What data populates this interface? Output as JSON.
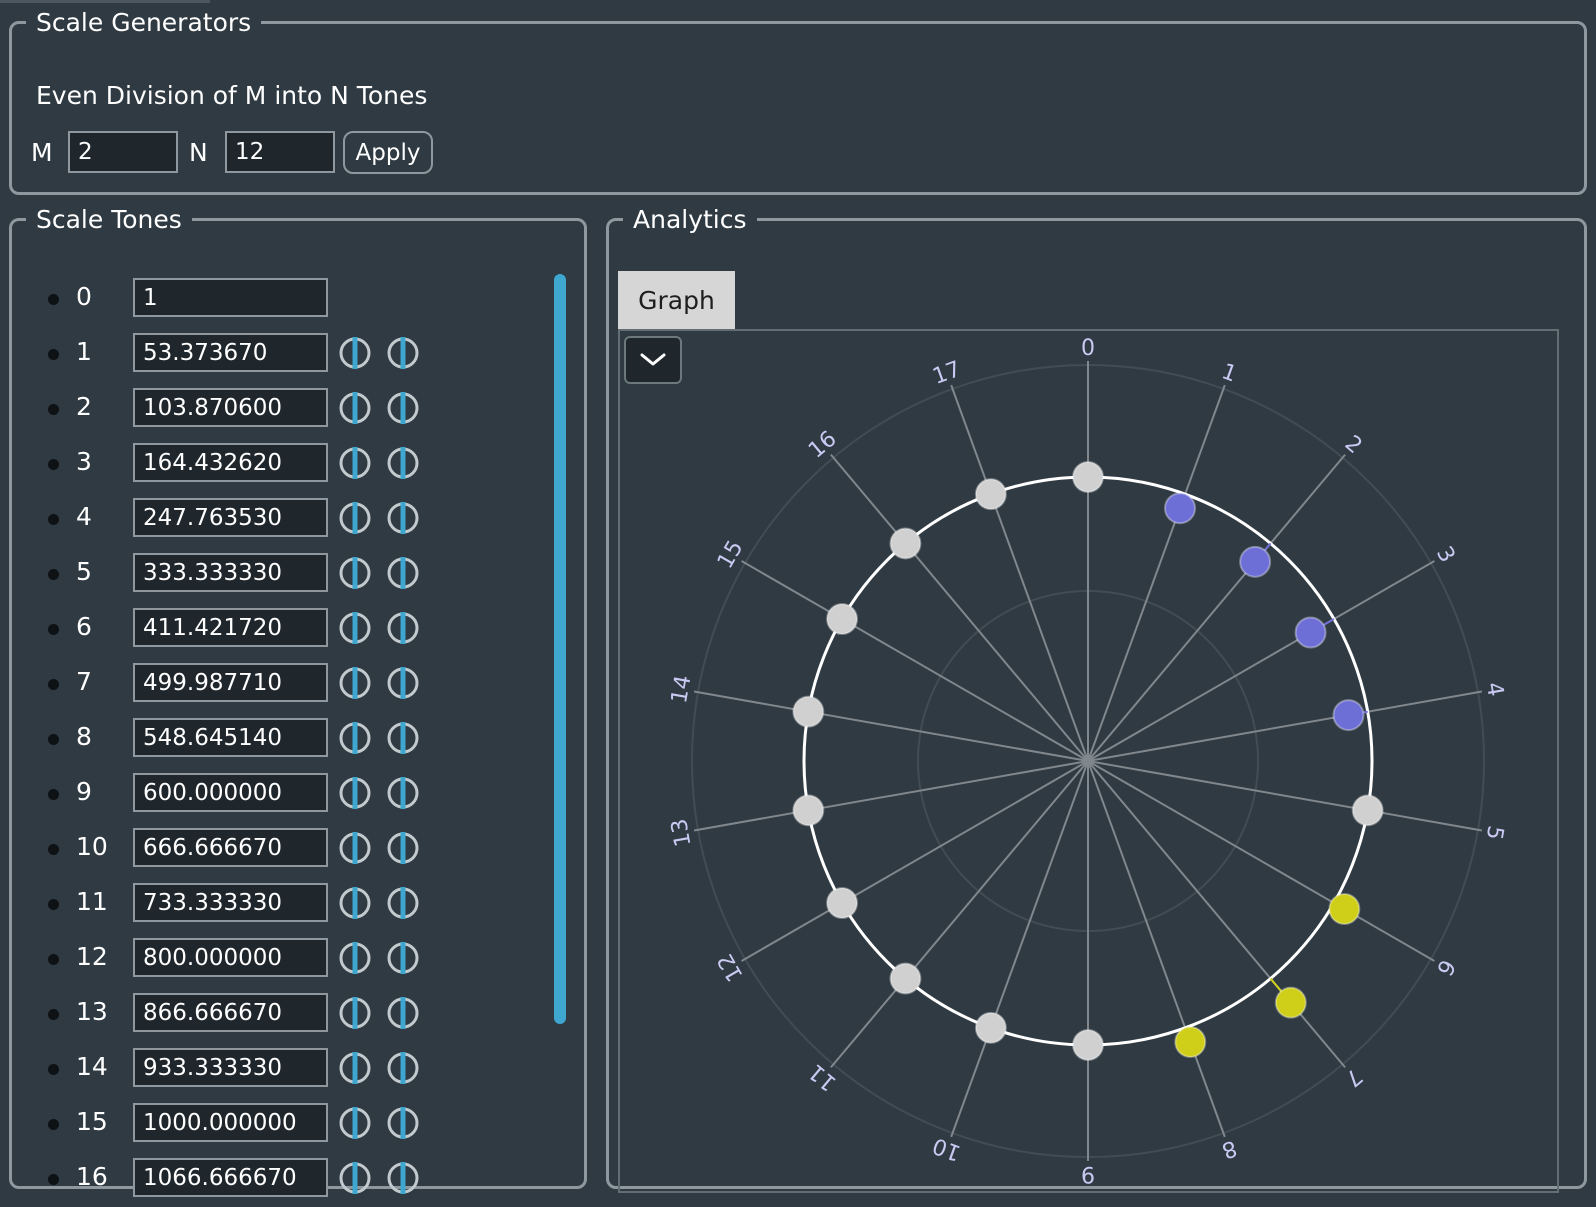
{
  "generators": {
    "legend": "Scale Generators",
    "title": "Even Division of M into N Tones",
    "m_label": "M",
    "m_value": "2",
    "n_label": "N",
    "n_value": "12",
    "apply_label": "Apply"
  },
  "tones": {
    "legend": "Scale Tones",
    "items": [
      {
        "index": "0",
        "value": "1"
      },
      {
        "index": "1",
        "value": "53.373670"
      },
      {
        "index": "2",
        "value": "103.870600"
      },
      {
        "index": "3",
        "value": "164.432620"
      },
      {
        "index": "4",
        "value": "247.763530"
      },
      {
        "index": "5",
        "value": "333.333330"
      },
      {
        "index": "6",
        "value": "411.421720"
      },
      {
        "index": "7",
        "value": "499.987710"
      },
      {
        "index": "8",
        "value": "548.645140"
      },
      {
        "index": "9",
        "value": "600.000000"
      },
      {
        "index": "10",
        "value": "666.666670"
      },
      {
        "index": "11",
        "value": "733.333330"
      },
      {
        "index": "12",
        "value": "800.000000"
      },
      {
        "index": "13",
        "value": "866.666670"
      },
      {
        "index": "14",
        "value": "933.333330"
      },
      {
        "index": "15",
        "value": "1000.000000"
      },
      {
        "index": "16",
        "value": "1066.666670"
      }
    ]
  },
  "analytics": {
    "legend": "Analytics",
    "tab_label": "Graph",
    "dropdown_icon": "chevron-down-icon",
    "colors": {
      "neutral": "#d0d0d0",
      "flat": "#6d6fd6",
      "sharp": "#cfcf1a",
      "ring": "#ffffff",
      "label": "#c9c9f2"
    }
  },
  "chart_data": {
    "type": "polar",
    "spoke_labels": [
      "0",
      "1",
      "2",
      "3",
      "4",
      "5",
      "6",
      "7",
      "8",
      "9",
      "10",
      "11",
      "12",
      "13",
      "14",
      "15",
      "16",
      "17"
    ],
    "points": [
      {
        "spoke": 0,
        "deviation": 0,
        "status": "neutral"
      },
      {
        "spoke": 1,
        "deviation": -0.1,
        "status": "flat"
      },
      {
        "spoke": 2,
        "deviation": -0.16,
        "status": "flat"
      },
      {
        "spoke": 3,
        "deviation": -0.18,
        "status": "flat"
      },
      {
        "spoke": 4,
        "deviation": -0.13,
        "status": "flat"
      },
      {
        "spoke": 5,
        "deviation": 0,
        "status": "neutral"
      },
      {
        "spoke": 6,
        "deviation": 0.08,
        "status": "sharp"
      },
      {
        "spoke": 7,
        "deviation": 0.21,
        "status": "sharp"
      },
      {
        "spoke": 8,
        "deviation": 0.1,
        "status": "sharp"
      },
      {
        "spoke": 9,
        "deviation": 0,
        "status": "neutral"
      },
      {
        "spoke": 10,
        "deviation": 0,
        "status": "neutral"
      },
      {
        "spoke": 11,
        "deviation": 0,
        "status": "neutral"
      },
      {
        "spoke": 12,
        "deviation": 0,
        "status": "neutral"
      },
      {
        "spoke": 13,
        "deviation": 0,
        "status": "neutral"
      },
      {
        "spoke": 14,
        "deviation": 0,
        "status": "neutral"
      },
      {
        "spoke": 15,
        "deviation": 0,
        "status": "neutral"
      },
      {
        "spoke": 16,
        "deviation": 0,
        "status": "neutral"
      },
      {
        "spoke": 17,
        "deviation": 0,
        "status": "neutral"
      }
    ]
  }
}
